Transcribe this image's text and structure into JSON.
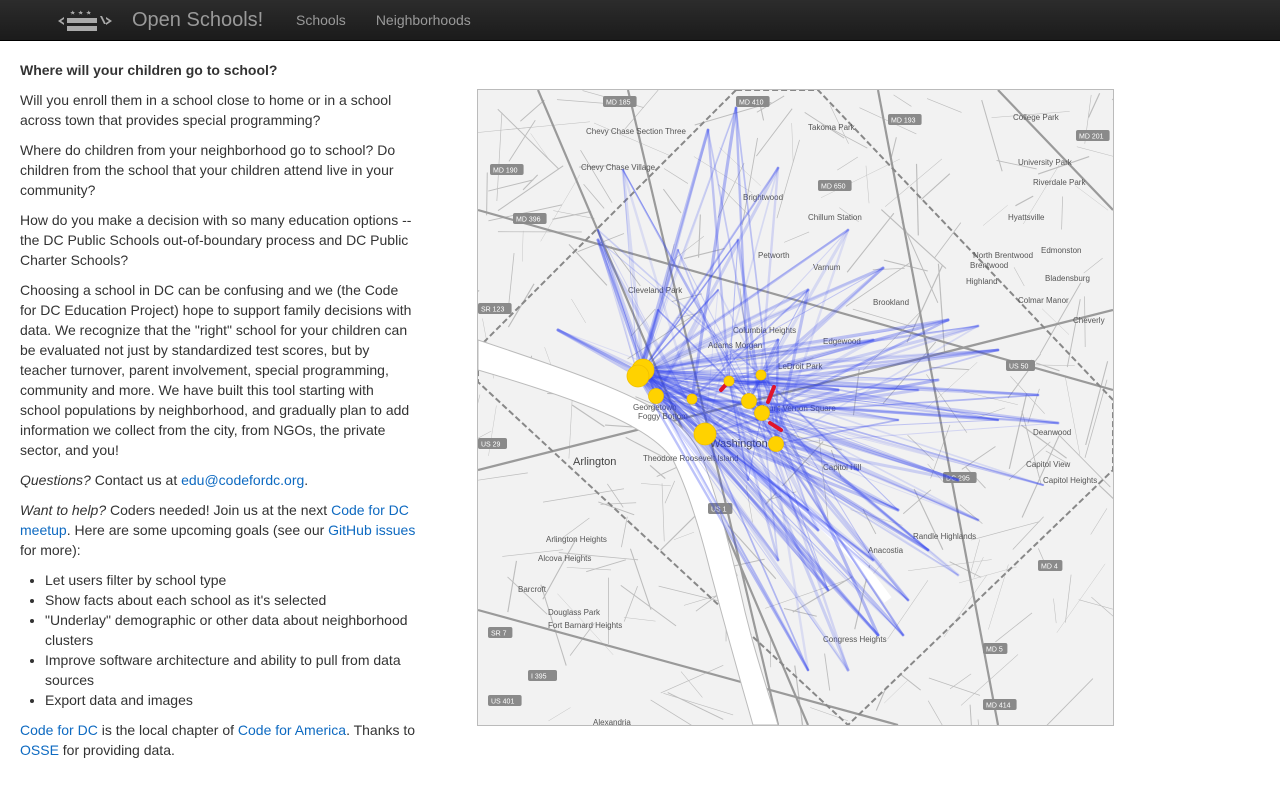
{
  "nav": {
    "brand": "Open Schools!",
    "logo_icon": "dc-flag-code-icon",
    "items": [
      {
        "label": "Schools"
      },
      {
        "label": "Neighborhoods"
      }
    ]
  },
  "content": {
    "heading": "Where will your children go to school?",
    "p1": "Will you enroll them in a school close to home or in a school across town that provides special programming?",
    "p2": "Where do children from your neighborhood go to school? Do children from the school that your children attend live in your community?",
    "p3": "How do you make a decision with so many education options -- the DC Public Schools out-of-boundary process and DC Public Charter Schools?",
    "p4": "Choosing a school in DC can be confusing and we (the Code for DC Education Project) hope to support family decisions with data. We recognize that the \"right\" school for your children can be evaluated not just by standardized test scores, but by teacher turnover, parent involvement, special programming, community and more. We have built this tool starting with school populations by neighborhood, and gradually plan to add information we collect from the city, from NGOs, the private sector, and you!",
    "questions": {
      "em": "Questions?",
      "text": " Contact us at ",
      "email": "edu@codefordc.org",
      "end": "."
    },
    "help": {
      "em": "Want to help?",
      "text1": " Coders needed! Join us at the next ",
      "meetup_link": "Code for DC meetup",
      "text2": ". Here are some upcoming goals (see our ",
      "github_link": "GitHub issues",
      "text3": " for more):"
    },
    "goals": [
      "Let users filter by school type",
      "Show facts about each school as it's selected",
      "\"Underlay\" demographic or other data about neighborhood clusters",
      "Improve software architecture and ability to pull from data sources",
      "Export data and images"
    ],
    "footer": {
      "cfdc_link": "Code for DC",
      "text1": " is the local chapter of ",
      "cfa_link": "Code for America",
      "text2": ". Thanks to ",
      "osse_link": "OSSE",
      "text3": " for providing data."
    }
  },
  "map": {
    "colors": {
      "flow": "#3344ee",
      "school": "#ffd200",
      "selected": "#e0142c"
    },
    "place_labels": [
      "Chevy Chase Section Three",
      "Chevy Chase Village",
      "Takoma Park",
      "College Park",
      "University Park",
      "Riverdale Park",
      "Brightwood",
      "Chillum Station",
      "Hyattsville",
      "Petworth",
      "Varnum",
      "North Brentwood",
      "Brentwood",
      "Edmonston",
      "Highland",
      "Bladensburg",
      "Colmar Manor",
      "Cleveland Park",
      "Brookland",
      "Cheverly",
      "Columbia Heights",
      "Edgewood",
      "Adams Morgan",
      "LeDroit Park",
      "Georgetown",
      "Foggy Bottom",
      "Mount Vernon Square",
      "Deanwood",
      "Washington",
      "Arlington",
      "Capitol Hill",
      "Theodore Roosevelt Island",
      "Capitol View",
      "Capitol Heights",
      "Arlington Heights",
      "Randle Highlands",
      "Alcova Heights",
      "Anacostia",
      "Barcroft",
      "Douglass Park",
      "Fort Barnard Heights",
      "Congress Heights",
      "Alexandria"
    ],
    "road_labels": [
      "MD 185",
      "MD 410",
      "MD 193",
      "MD 201",
      "MD 190",
      "MD 650",
      "MD 396",
      "SR 123",
      "US 50",
      "US 29",
      "DC 295",
      "US 1",
      "SR 7",
      "I 395",
      "US 401",
      "MD 4",
      "MD 5",
      "MD 414"
    ],
    "schools": [
      {
        "name": "school-a",
        "size": "large"
      },
      {
        "name": "school-b",
        "size": "large"
      },
      {
        "name": "school-c",
        "size": "medium"
      },
      {
        "name": "school-d",
        "size": "small"
      },
      {
        "name": "school-e",
        "size": "small"
      },
      {
        "name": "school-f",
        "size": "small"
      },
      {
        "name": "school-g",
        "size": "medium"
      },
      {
        "name": "school-h",
        "size": "medium"
      },
      {
        "name": "school-i",
        "size": "large"
      },
      {
        "name": "school-j",
        "size": "medium"
      }
    ]
  }
}
